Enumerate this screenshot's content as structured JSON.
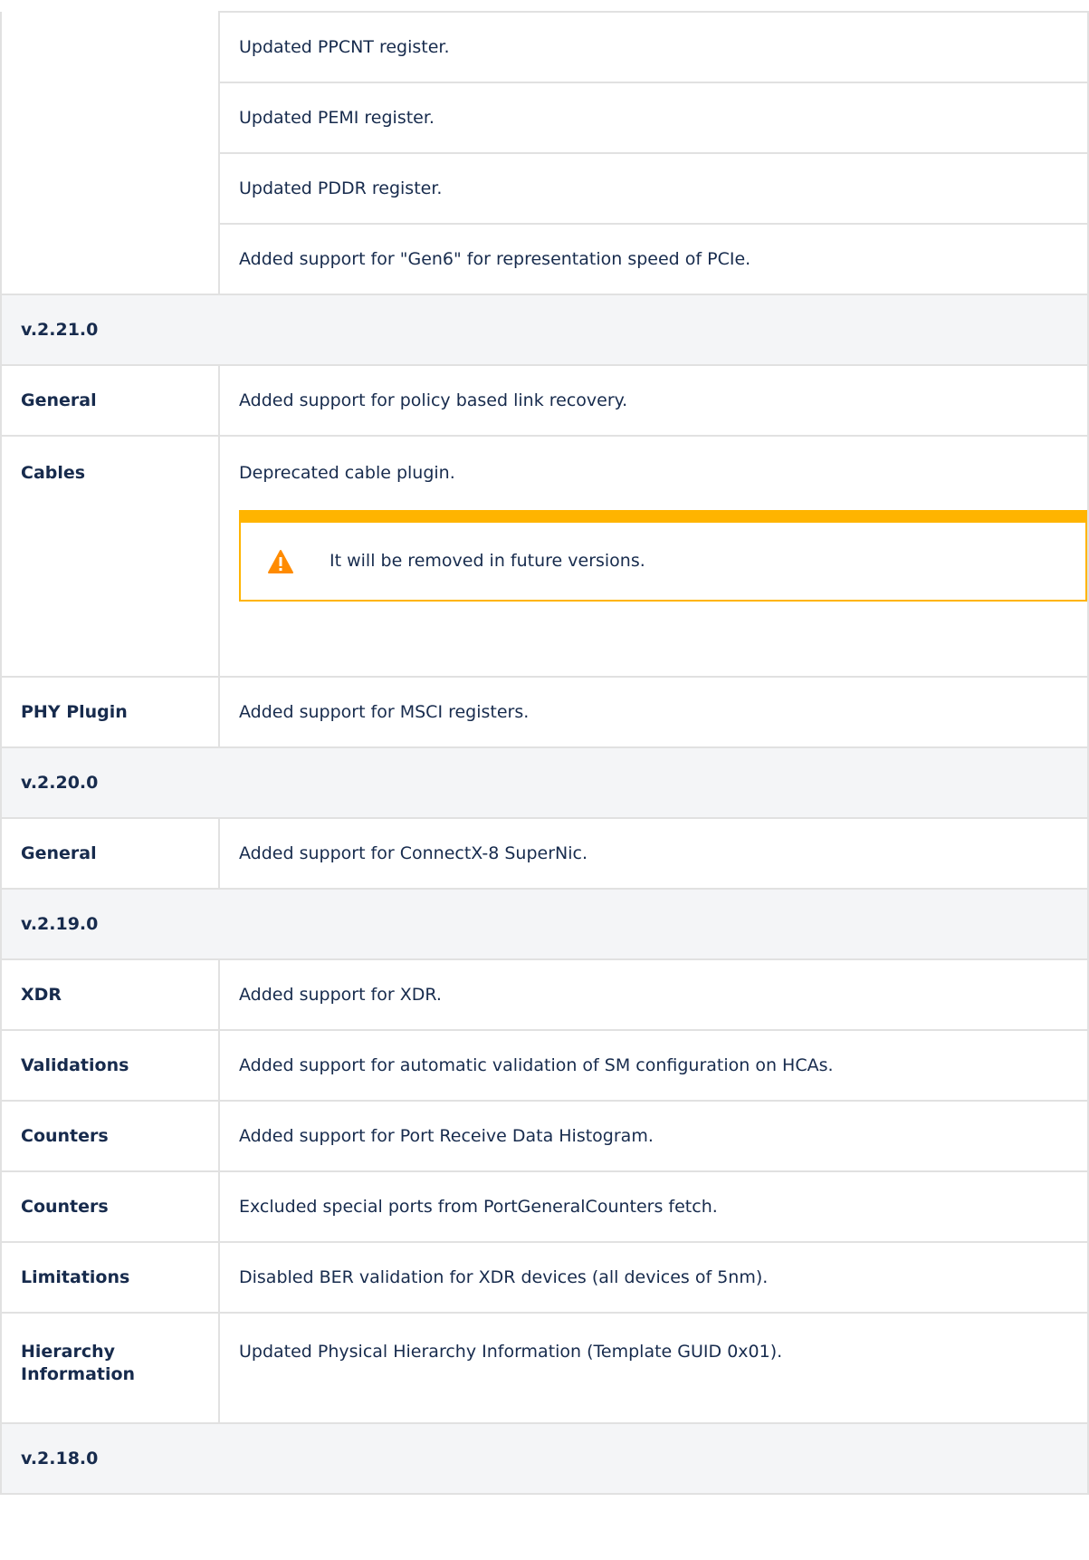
{
  "rows_top": [
    {
      "label": "",
      "text": "Updated PPCNT register."
    },
    {
      "label": "",
      "text": "Updated PEMI register."
    },
    {
      "label": "",
      "text": "Updated PDDR register."
    },
    {
      "label": "",
      "text": "Added support for \"Gen6\" for representation speed of PCIe."
    }
  ],
  "v2_21_0": {
    "version": "v.2.21.0",
    "general_label": "General",
    "general_text": "Added support for policy based link recovery.",
    "cables_label": "Cables",
    "cables_text": "Deprecated cable plugin.",
    "warning_text": "It will be removed in future versions.",
    "phy_label": "PHY Plugin",
    "phy_text": "Added support for MSCI registers."
  },
  "v2_20_0": {
    "version": "v.2.20.0",
    "general_label": "General",
    "general_text": "Added support for ConnectX-8 SuperNic."
  },
  "v2_19_0": {
    "version": "v.2.19.0",
    "rows": [
      {
        "label": "XDR",
        "text": "Added support for XDR."
      },
      {
        "label": "Validations",
        "text": "Added support for automatic validation of SM configuration on HCAs."
      },
      {
        "label": "Counters",
        "text": "Added support for Port Receive Data Histogram."
      },
      {
        "label": "Counters",
        "text": "Excluded special ports from  PortGeneralCounters fetch."
      },
      {
        "label": "Limitations",
        "text": "Disabled BER validation for XDR devices (all devices of 5nm)."
      },
      {
        "label": "Hierarchy Information",
        "text": "Updated Physical Hierarchy Information (Template GUID 0x01)."
      }
    ]
  },
  "v2_18_0": {
    "version": "v.2.18.0"
  },
  "colors": {
    "warning": "#ffb400",
    "warning_icon": "#ff8b00",
    "version_row_bg": "#f4f5f7",
    "border": "#e1e1e1"
  },
  "icons": {
    "warning": "warning-icon"
  }
}
